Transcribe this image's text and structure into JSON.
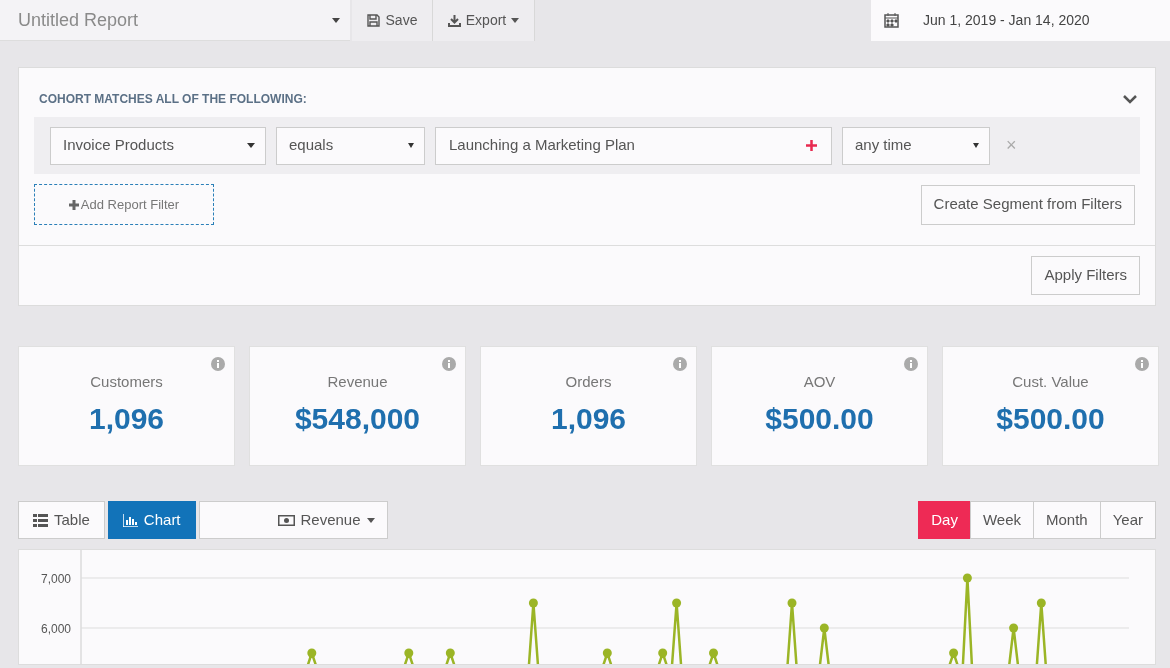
{
  "toolbar": {
    "title": "Untitled Report",
    "save": "Save",
    "export": "Export",
    "date_range": "Jun 1, 2019 - Jan 14, 2020"
  },
  "filters": {
    "heading": "COHORT MATCHES ALL OF THE FOLLOWING:",
    "rule": {
      "field": "Invoice Products",
      "operator": "equals",
      "value": "Launching a Marketing Plan",
      "when": "any time",
      "remove": "×"
    },
    "add": "Add Report Filter",
    "create_segment": "Create Segment from Filters",
    "apply": "Apply Filters"
  },
  "stats": [
    {
      "label": "Customers",
      "value": "1,096"
    },
    {
      "label": "Revenue",
      "value": "$548,000"
    },
    {
      "label": "Orders",
      "value": "1,096"
    },
    {
      "label": "AOV",
      "value": "$500.00"
    },
    {
      "label": "Cust. Value",
      "value": "$500.00"
    }
  ],
  "views": [
    {
      "label": "Table",
      "kind": "table",
      "selected": false
    },
    {
      "label": "Chart",
      "kind": "chart",
      "selected": true
    }
  ],
  "metric": "Revenue",
  "periods": [
    {
      "label": "Day",
      "selected": true
    },
    {
      "label": "Week",
      "selected": false
    },
    {
      "label": "Month",
      "selected": false
    },
    {
      "label": "Year",
      "selected": false
    }
  ],
  "chart": {
    "y_labels": [
      "7,000",
      "6,000"
    ]
  }
}
